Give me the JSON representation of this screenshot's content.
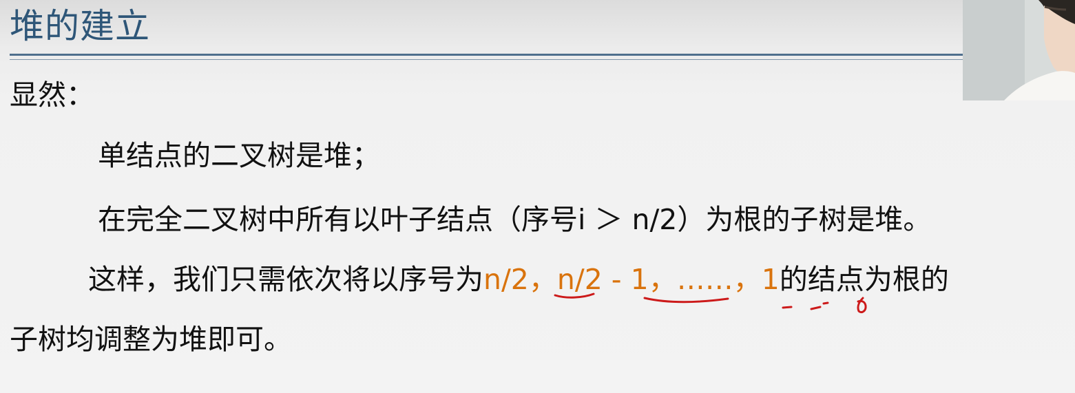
{
  "slide": {
    "title": "堆的建立",
    "obviously": "显然：",
    "line1": "单结点的二叉树是堆；",
    "line2": "在完全二叉树中所有以叶子结点（序号i ＞ n/2）为根的子树是堆。",
    "line3": {
      "before": "这样，我们只需依次将以序号为",
      "hl1": "n/2",
      "sep1": "，",
      "hl2": "n/2 - 1",
      "sep2": "，",
      "hl3": "……",
      "sep3": "，",
      "hl4": "1",
      "after": "的结点为根的"
    },
    "line4": "子树均调整为堆即可。"
  },
  "colors": {
    "title": "#2e5678",
    "highlight": "#d9730d",
    "annotation": "#cc1a1a"
  }
}
